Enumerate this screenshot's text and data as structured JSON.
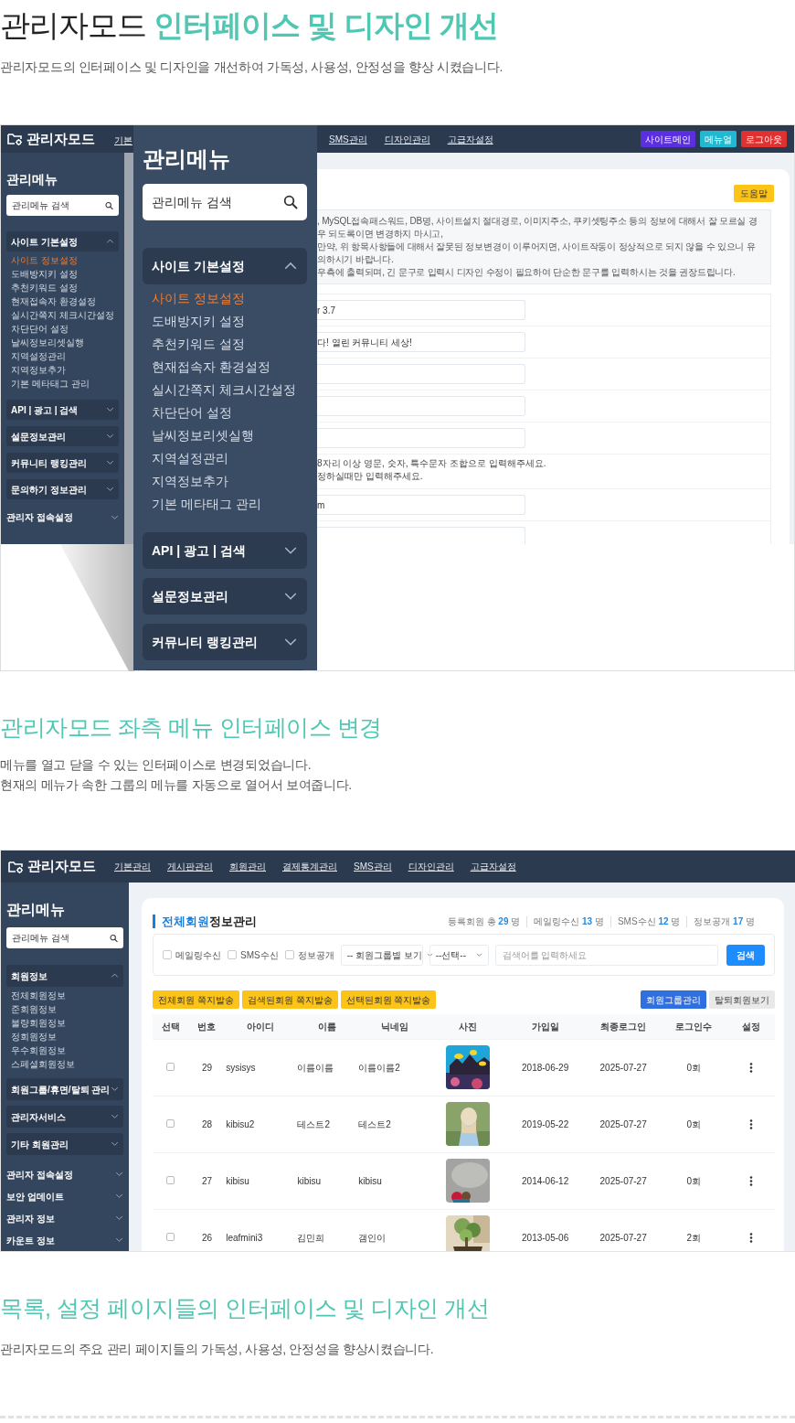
{
  "hero": {
    "title_prefix": "관리자모드",
    "title_highlight": "인터페이스 및 디자인 개선",
    "description": "관리자모드의 인터페이스 및 디자인을 개선하여 가독성, 사용성, 안정성을 향상 시켰습니다."
  },
  "screenshot_1": {
    "topbar": {
      "logo": "관리자모드",
      "nav": [
        "기본",
        "SMS관리",
        "디자인관리",
        "고급자설정"
      ],
      "buttons": [
        {
          "label": "사이트메인",
          "color": "#5b2ee0"
        },
        {
          "label": "메뉴얼",
          "color": "#22b8cf"
        },
        {
          "label": "로그아웃",
          "color": "#e03131"
        }
      ]
    },
    "sidebar": {
      "title": "관리메뉴",
      "search_placeholder": "관리메뉴 검색",
      "groups": [
        {
          "label": "사이트 기본설정",
          "kind": "box",
          "expanded": true,
          "items": [
            {
              "label": "사이트 정보설정",
              "selected": true
            },
            {
              "label": "도배방지키 설정",
              "selected": false
            },
            {
              "label": "추천키워드 설정",
              "selected": false
            },
            {
              "label": "현재접속자 환경설정",
              "selected": false
            },
            {
              "label": "실시간쪽지 체크시간설정",
              "selected": false
            },
            {
              "label": "차단단어 설정",
              "selected": false
            },
            {
              "label": "날씨정보리셋실행",
              "selected": false
            },
            {
              "label": "지역설정관리",
              "selected": false
            },
            {
              "label": "지역정보추가",
              "selected": false
            },
            {
              "label": "기본 메타태그 관리",
              "selected": false
            }
          ]
        },
        {
          "label": "API | 광고 | 검색",
          "kind": "box",
          "expanded": false
        },
        {
          "label": "설문정보관리",
          "kind": "box",
          "expanded": false
        },
        {
          "label": "커뮤니티 랭킹관리",
          "kind": "box",
          "expanded": false
        },
        {
          "label": "문의하기 정보관리",
          "kind": "box",
          "expanded": false
        },
        {
          "label": "관리자 접속설정",
          "kind": "plain",
          "expanded": false
        }
      ]
    },
    "content": {
      "help_button": "도움말",
      "notice_lines": [
        ", MySQL접속패스워드, DB명, 사이트설치 절대경로, 이미지주소, 쿠키셋팅주소 등의 정보에 대해서 잘 모르실 경우 되도록이면 변경하지 마시고,",
        "만약, 위 항목사항들에 대해서 잘못된 정보변경이 이루어지면, 사이트작동이 정상적으로 되지 않을 수 있으니 유의하시기 바랍니다.",
        "우측에 출력되며, 긴 문구로 입력시 디자인 수정이 필요하여 단순한 문구를 입력하시는 것을 권장드립니다."
      ],
      "form_rows": [
        {
          "kind": "input",
          "value": "r 3.7"
        },
        {
          "kind": "input",
          "value": "다! 열린 커뮤니티 세상!"
        },
        {
          "kind": "input"
        },
        {
          "kind": "input"
        },
        {
          "kind": "input"
        },
        {
          "kind": "hint",
          "lines": [
            "8자리 이상 영문, 숫자, 특수문자 조합으로 입력해주세요.",
            "정하실때만 입력해주세요."
          ]
        },
        {
          "kind": "input",
          "value": "m"
        },
        {
          "kind": "input"
        }
      ]
    },
    "zoom_panel": {
      "title": "관리메뉴",
      "search_placeholder": "관리메뉴 검색",
      "groups": [
        {
          "label": "사이트 기본설정",
          "kind": "box",
          "expanded": true,
          "items": [
            {
              "label": "사이트 정보설정",
              "selected": true
            },
            {
              "label": "도배방지키 설정",
              "selected": false
            },
            {
              "label": "추천키워드 설정",
              "selected": false
            },
            {
              "label": "현재접속자 환경설정",
              "selected": false
            },
            {
              "label": "실시간쪽지 체크시간설정",
              "selected": false
            },
            {
              "label": "차단단어 설정",
              "selected": false
            },
            {
              "label": "날씨정보리셋실행",
              "selected": false
            },
            {
              "label": "지역설정관리",
              "selected": false
            },
            {
              "label": "지역정보추가",
              "selected": false
            },
            {
              "label": "기본 메타태그 관리",
              "selected": false
            }
          ]
        },
        {
          "label": "API | 광고 | 검색",
          "kind": "box",
          "expanded": false
        },
        {
          "label": "설문정보관리",
          "kind": "box",
          "expanded": false
        },
        {
          "label": "커뮤니티 랭킹관리",
          "kind": "box",
          "expanded": false
        },
        {
          "kind": "box"
        }
      ]
    }
  },
  "section_2": {
    "heading": "관리자모드 좌측 메뉴 인터페이스 변경",
    "description_lines": [
      "메뉴를 열고 닫을 수 있는 인터페이스로 변경되었습니다.",
      "현재의 메뉴가 속한 그룹의 메뉴를 자동으로 열어서 보여줍니다."
    ]
  },
  "screenshot_2": {
    "topbar": {
      "logo": "관리자모드",
      "nav": [
        "기본관리",
        "게시판관리",
        "회원관리",
        "결제통계관리",
        "SMS관리",
        "디자인관리",
        "고급자설정"
      ]
    },
    "sidebar": {
      "title": "관리메뉴",
      "search_placeholder": "관리메뉴 검색",
      "groups": [
        {
          "label": "회원정보",
          "kind": "box",
          "expanded": true,
          "items": [
            {
              "label": "전체회원정보",
              "selected": false
            },
            {
              "label": "준회원정보",
              "selected": false
            },
            {
              "label": "불량회원정보",
              "selected": false
            },
            {
              "label": "정회원정보",
              "selected": false
            },
            {
              "label": "우수회원정보",
              "selected": false
            },
            {
              "label": "스페셜회원정보",
              "selected": false
            }
          ]
        },
        {
          "label": "회원그룹/휴면/탈퇴 관리",
          "kind": "box",
          "expanded": false
        },
        {
          "label": "관리자서비스",
          "kind": "box",
          "expanded": false
        },
        {
          "label": "기타 회원관리",
          "kind": "box",
          "expanded": false
        },
        {
          "label": "관리자 접속설정",
          "kind": "plain",
          "expanded": false
        },
        {
          "label": "보안 업데이트",
          "kind": "plain",
          "expanded": false
        },
        {
          "label": "관리자 정보",
          "kind": "plain",
          "expanded": false
        },
        {
          "label": "카운트 정보",
          "kind": "plain",
          "expanded": false
        }
      ]
    },
    "content": {
      "title_highlight": "전체회원",
      "title_rest": "정보관리",
      "stats": [
        {
          "label": "등록회원 총",
          "count": "29",
          "unit": "명"
        },
        {
          "label": "메일링수신",
          "count": "13",
          "unit": "명"
        },
        {
          "label": "SMS수신",
          "count": "12",
          "unit": "명"
        },
        {
          "label": "정보공개",
          "count": "17",
          "unit": "명"
        }
      ],
      "filters": [
        {
          "label": "메일링수신",
          "checked": false
        },
        {
          "label": "SMS수신",
          "checked": false
        },
        {
          "label": "정보공개",
          "checked": false
        }
      ],
      "selects": [
        "-- 회원그룹별 보기",
        "--선택--"
      ],
      "search_placeholder": "검색어를 입력하세요",
      "search_button": "검색",
      "action_buttons": [
        {
          "label": "전체회원 쪽지발송",
          "kind": "warning"
        },
        {
          "label": "검색된회원 쪽지발송",
          "kind": "warning"
        },
        {
          "label": "선택된회원 쪽지발송",
          "kind": "warning"
        }
      ],
      "right_buttons": [
        {
          "label": "회원그룹관리",
          "kind": "primary"
        },
        {
          "label": "탈퇴회원보기",
          "kind": "secondary"
        }
      ],
      "table": {
        "columns": [
          "선택",
          "번호",
          "아이디",
          "이름",
          "닉네임",
          "사진",
          "가입일",
          "최종로그인",
          "로그인수",
          "설정"
        ],
        "rows": [
          {
            "checked": false,
            "number": "29",
            "user_id": "sysisys",
            "name": "이름이름",
            "nickname": "이름이름2",
            "joined": "2018-06-29",
            "last_login": "2025-07-27",
            "login_count": "0회"
          },
          {
            "checked": false,
            "number": "28",
            "user_id": "kibisu2",
            "name": "테스트2",
            "nickname": "테스트2",
            "joined": "2019-05-22",
            "last_login": "2025-07-27",
            "login_count": "0회"
          },
          {
            "checked": false,
            "number": "27",
            "user_id": "kibisu",
            "name": "kibisu",
            "nickname": "kibisu",
            "joined": "2014-06-12",
            "last_login": "2025-07-27",
            "login_count": "0회"
          },
          {
            "checked": false,
            "number": "26",
            "user_id": "leafmini3",
            "name": "김민희",
            "nickname": "갬인이",
            "joined": "2013-05-06",
            "last_login": "2025-07-27",
            "login_count": "2회"
          }
        ]
      }
    }
  },
  "section_3": {
    "heading": "목록, 설정 페이지들의 인터페이스 및 디자인 개선",
    "description": "관리자모드의 주요 관리 페이지들의 가독성, 사용성, 안정성을 향상시켰습니다."
  }
}
